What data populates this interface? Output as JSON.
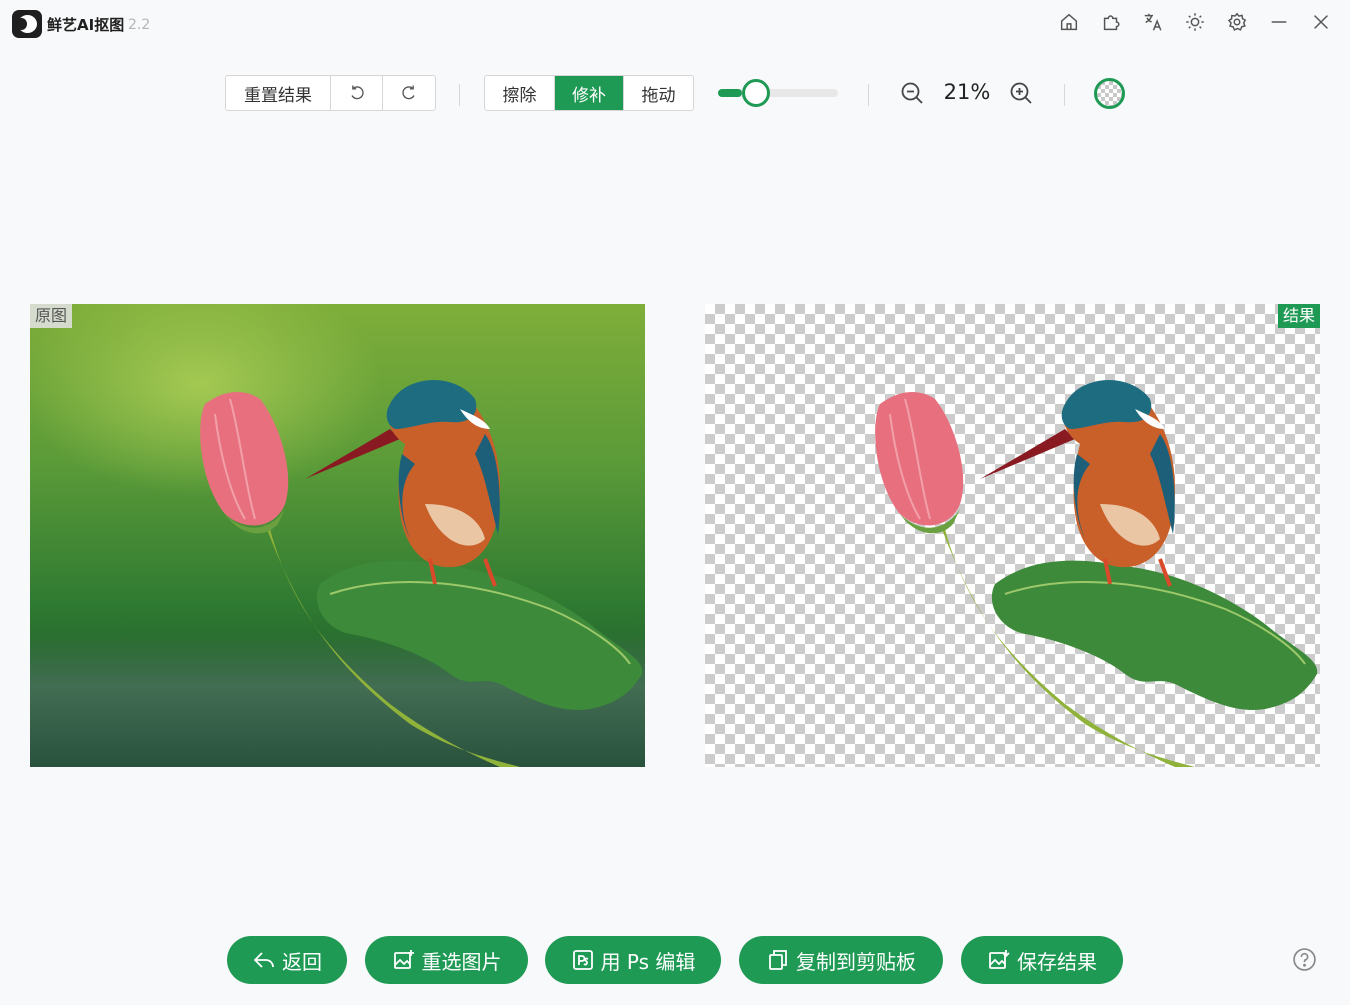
{
  "app": {
    "name": "鲜艺AI抠图",
    "version": "2.2"
  },
  "titlebar": {
    "icons": [
      "home-icon",
      "puzzle-icon",
      "translate-icon",
      "brightness-icon",
      "gear-icon",
      "minimize-icon",
      "close-icon"
    ]
  },
  "toolbar": {
    "reset_label": "重置结果",
    "undo_icon": "undo-icon",
    "redo_icon": "redo-icon",
    "modes": [
      {
        "label": "擦除",
        "active": false
      },
      {
        "label": "修补",
        "active": true
      },
      {
        "label": "拖动",
        "active": false
      }
    ],
    "brush_level": 0.13,
    "zoom_out_icon": "zoom-out-icon",
    "zoom_level": "21%",
    "zoom_in_icon": "zoom-in-icon",
    "background_toggle_icon": "transparent-background-icon"
  },
  "panels": {
    "original_label": "原图",
    "result_label": "结果"
  },
  "actions": {
    "back": "返回",
    "reselect": "重选图片",
    "ps_edit": "用 Ps 编辑",
    "copy": "复制到剪贴板",
    "save": "保存结果"
  },
  "colors": {
    "accent": "#1f9a55"
  },
  "help_icon": "help-circle-icon"
}
